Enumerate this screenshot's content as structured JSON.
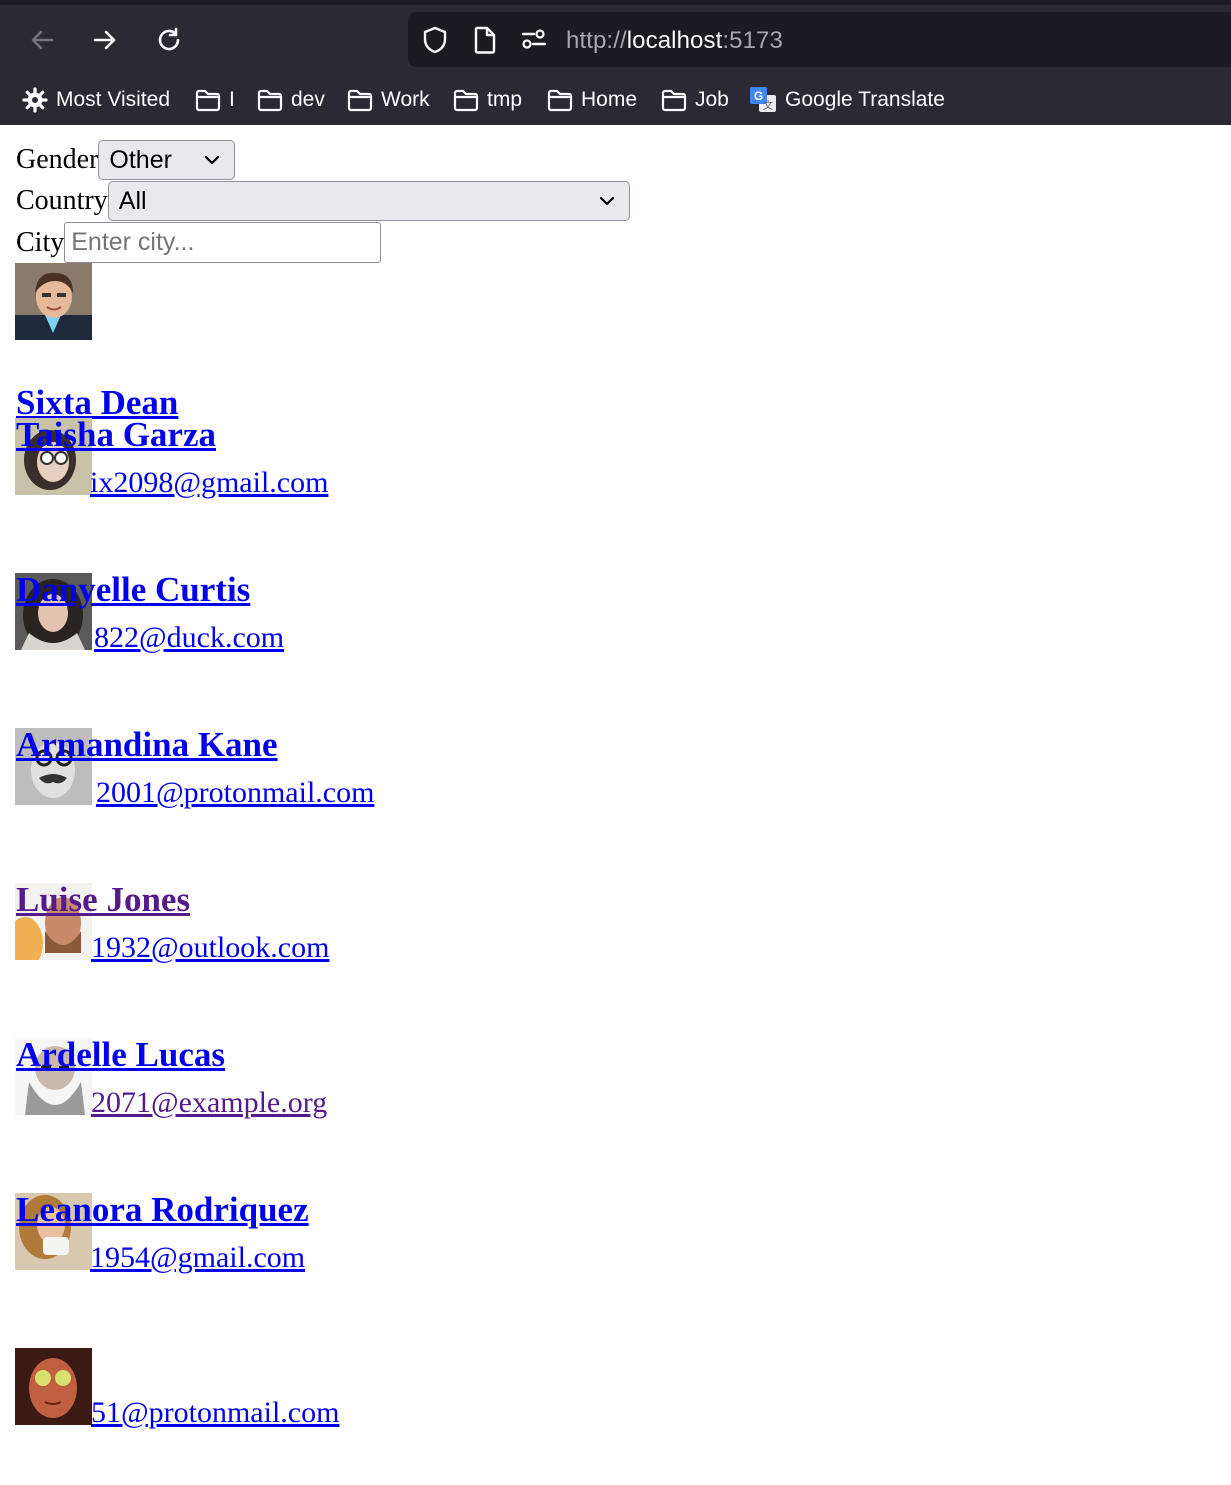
{
  "browser": {
    "url_scheme": "http://",
    "url_host": "localhost",
    "url_port": ":5173",
    "bookmarks": [
      "Most Visited",
      "I",
      "dev",
      "Work",
      "tmp",
      "Home",
      "Job",
      "Google Translate"
    ]
  },
  "filters": {
    "gender_label": "Gender",
    "gender_value": "Other",
    "country_label": "Country",
    "country_value": "All",
    "city_label": "City",
    "city_placeholder": "Enter city..."
  },
  "users": [
    {
      "name": "Sixta Dean",
      "email_visible": "ix2098@gmail.com"
    },
    {
      "name": "Taisha Garza",
      "email_visible": "822@duck.com"
    },
    {
      "name": "Danyelle Curtis",
      "email_visible": "2001@protonmail.com"
    },
    {
      "name": "Armandina Kane",
      "email_visible": "1932@outlook.com"
    },
    {
      "name": "Luise Jones",
      "email_visible": "2071@example.org",
      "visited": true
    },
    {
      "name": "Ardelle Lucas",
      "email_visible": "1954@gmail.com"
    },
    {
      "name": "Leanora Rodriquez",
      "email_visible": "51@protonmail.com"
    }
  ],
  "colors": {
    "link": "#0000ee",
    "visited_link": "#551a8b",
    "chrome_bg": "#2b2a33",
    "urlbar_bg": "#1c1b22"
  }
}
